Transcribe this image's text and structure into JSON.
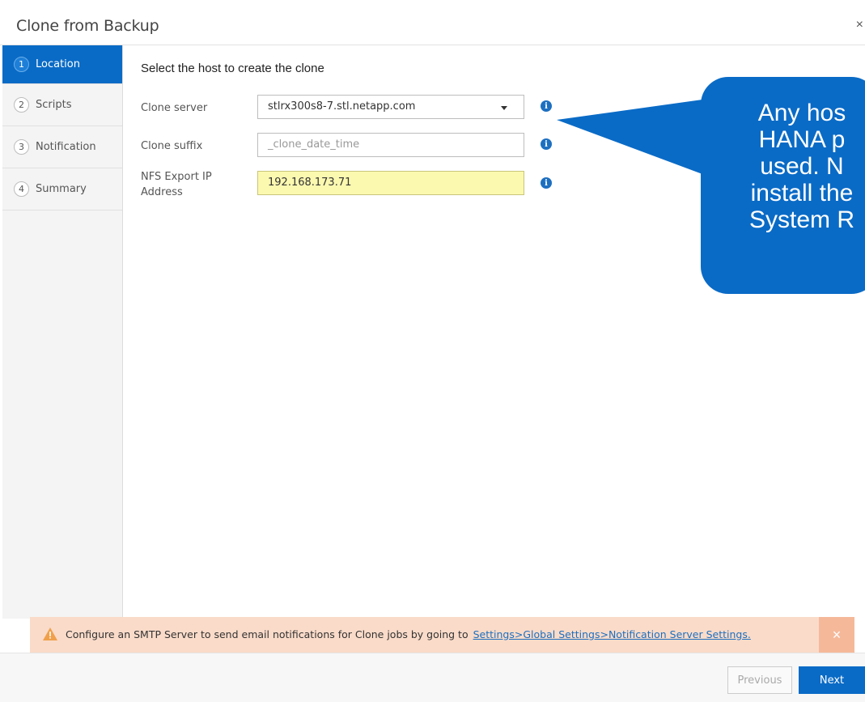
{
  "dialog": {
    "title": "Clone from Backup",
    "close_glyph": "×"
  },
  "steps": [
    {
      "num": "1",
      "label": "Location",
      "active": true
    },
    {
      "num": "2",
      "label": "Scripts",
      "active": false
    },
    {
      "num": "3",
      "label": "Notification",
      "active": false
    },
    {
      "num": "4",
      "label": "Summary",
      "active": false
    }
  ],
  "main": {
    "heading": "Select the host to create the clone",
    "clone_server": {
      "label": "Clone server",
      "value": "stlrx300s8-7.stl.netapp.com"
    },
    "clone_suffix": {
      "label": "Clone suffix",
      "placeholder": "_clone_date_time"
    },
    "nfs_export": {
      "label": "NFS Export IP Address",
      "value": "192.168.173.71"
    }
  },
  "callout": {
    "text": "Any hos\nHANA p\nused. N\ninstall the\nSystem R",
    "color": "#0a6bc6"
  },
  "warning": {
    "text": "Configure an SMTP Server to send email notifications for Clone jobs by going to",
    "link": "Settings>Global Settings>Notification Server Settings.",
    "close_glyph": "×"
  },
  "footer": {
    "previous_label": "Previous",
    "next_label": "Next"
  },
  "colors": {
    "accent": "#0a6bc6",
    "warning_bg": "#fadbc9",
    "highlight_field": "#fbf8b0"
  }
}
